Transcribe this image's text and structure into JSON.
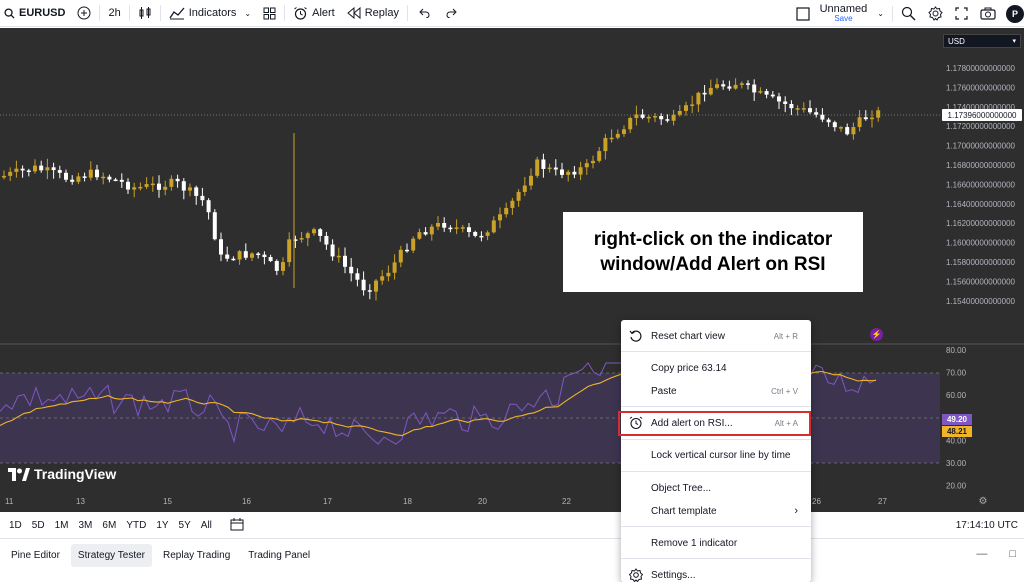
{
  "toolbar": {
    "symbol": "EURUSD",
    "interval": "2h",
    "indicators_label": "Indicators",
    "alert_label": "Alert",
    "replay_label": "Replay",
    "layout_name": "Unnamed",
    "save_label": "Save",
    "avatar_letter": "P"
  },
  "chart": {
    "currency": "USD",
    "current_price": "1.17396000000000",
    "price_ticks": [
      "1.17800000000000",
      "1.17600000000000",
      "1.17400000000000",
      "1.17200000000000",
      "1.17000000000000",
      "1.16800000000000",
      "1.16600000000000",
      "1.16400000000000",
      "1.16200000000000",
      "1.16000000000000",
      "1.15800000000000",
      "1.15600000000000",
      "1.15400000000000"
    ],
    "rsi_ticks": [
      "80.00",
      "70.00",
      "60.00",
      "50.00",
      "40.00",
      "30.00",
      "20.00"
    ],
    "rsi_value": "49.20",
    "rsi_ma_value": "48.21",
    "time_ticks": [
      "11",
      "13",
      "15",
      "16",
      "17",
      "18",
      "20",
      "22",
      "26",
      "27"
    ],
    "logo_text": "TradingView",
    "colors": {
      "bull": "#c9a227",
      "bear": "#ffffff",
      "rsi": "#7e57c2",
      "rsi_ma": "#f0b429",
      "bg": "#2e2e2e"
    }
  },
  "annotation": {
    "line1": "right-click on the indicator",
    "line2": "window/Add Alert on RSI"
  },
  "range_buttons": [
    "1D",
    "5D",
    "1M",
    "3M",
    "6M",
    "YTD",
    "1Y",
    "5Y",
    "All"
  ],
  "clock": "17:14:10 UTC",
  "bottom_tabs": [
    "Pine Editor",
    "Strategy Tester",
    "Replay Trading",
    "Trading Panel"
  ],
  "context_menu": {
    "reset": {
      "label": "Reset chart view",
      "shortcut": "Alt + R"
    },
    "copy_price": {
      "label": "Copy price 63.14"
    },
    "paste": {
      "label": "Paste",
      "shortcut": "Ctrl + V"
    },
    "add_alert": {
      "label": "Add alert on RSI...",
      "shortcut": "Alt + A"
    },
    "lock_cursor": {
      "label": "Lock vertical cursor line by time"
    },
    "object_tree": {
      "label": "Object Tree..."
    },
    "chart_template": {
      "label": "Chart template"
    },
    "remove_indicator": {
      "label": "Remove 1 indicator"
    },
    "settings": {
      "label": "Settings..."
    }
  }
}
